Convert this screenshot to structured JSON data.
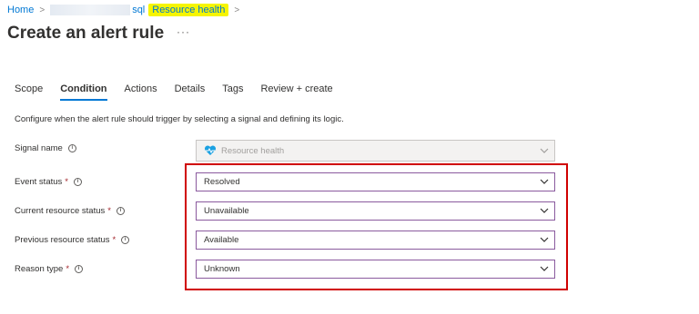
{
  "breadcrumb": {
    "home": "Home",
    "partial_resource": "sql",
    "current": "Resource health"
  },
  "page": {
    "title": "Create an alert rule",
    "more": "···"
  },
  "tabs": [
    {
      "label": "Scope"
    },
    {
      "label": "Condition"
    },
    {
      "label": "Actions"
    },
    {
      "label": "Details"
    },
    {
      "label": "Tags"
    },
    {
      "label": "Review + create"
    }
  ],
  "description": "Configure when the alert rule should trigger by selecting a signal and defining its logic.",
  "form": {
    "signal_name": {
      "label": "Signal name",
      "value": "Resource health",
      "icon": "heart-pulse-icon"
    },
    "event_status": {
      "label": "Event status",
      "required": "*",
      "value": "Resolved"
    },
    "current_resource_status": {
      "label": "Current resource status",
      "required": "*",
      "value": "Unavailable"
    },
    "previous_resource_status": {
      "label": "Previous resource status",
      "required": "*",
      "value": "Available"
    },
    "reason_type": {
      "label": "Reason type",
      "required": "*",
      "value": "Unknown"
    }
  },
  "colors": {
    "accent": "#0078d4",
    "highlight_yellow": "#f6f500",
    "annotation_red": "#d00000",
    "dropdown_border": "#8a5a9e",
    "required": "#a4262c"
  }
}
